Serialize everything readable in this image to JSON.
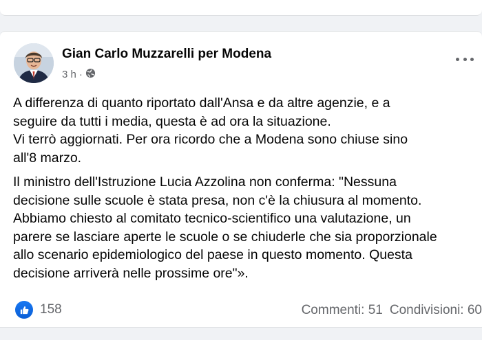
{
  "post": {
    "author": "Gian Carlo Muzzarelli per Modena",
    "time": "3 h",
    "separator": "·",
    "paragraphs": [
      "A differenza di quanto riportato dall'Ansa e da altre agenzie, e a",
      "seguire da tutti i media, questa è ad ora la situazione.",
      "Vi terrò aggiornati. Per ora ricordo che a Modena sono chiuse sino",
      "all'8 marzo.",
      "Il ministro dell'Istruzione Lucia Azzolina non conferma: \"Nessuna",
      "decisione sulle scuole è stata presa, non c'è la chiusura al momento.",
      "Abbiamo chiesto al comitato tecnico-scientifico una valutazione, un",
      "parere se lasciare aperte le scuole o se chiuderle che sia proporzionale",
      "allo scenario epidemiologico del paese in questo momento. Questa",
      "decisione arriverà nelle prossime ore\"»."
    ],
    "reaction_count": "158",
    "comments": "Commenti: 51",
    "shares": "Condivisioni: 60"
  },
  "icons": {
    "privacy": "globe-icon",
    "reaction": "like-icon",
    "menu": "more-options-icon"
  },
  "colors": {
    "accent": "#1877f2",
    "secondary_text": "#65676b",
    "background": "#f0f2f5"
  }
}
